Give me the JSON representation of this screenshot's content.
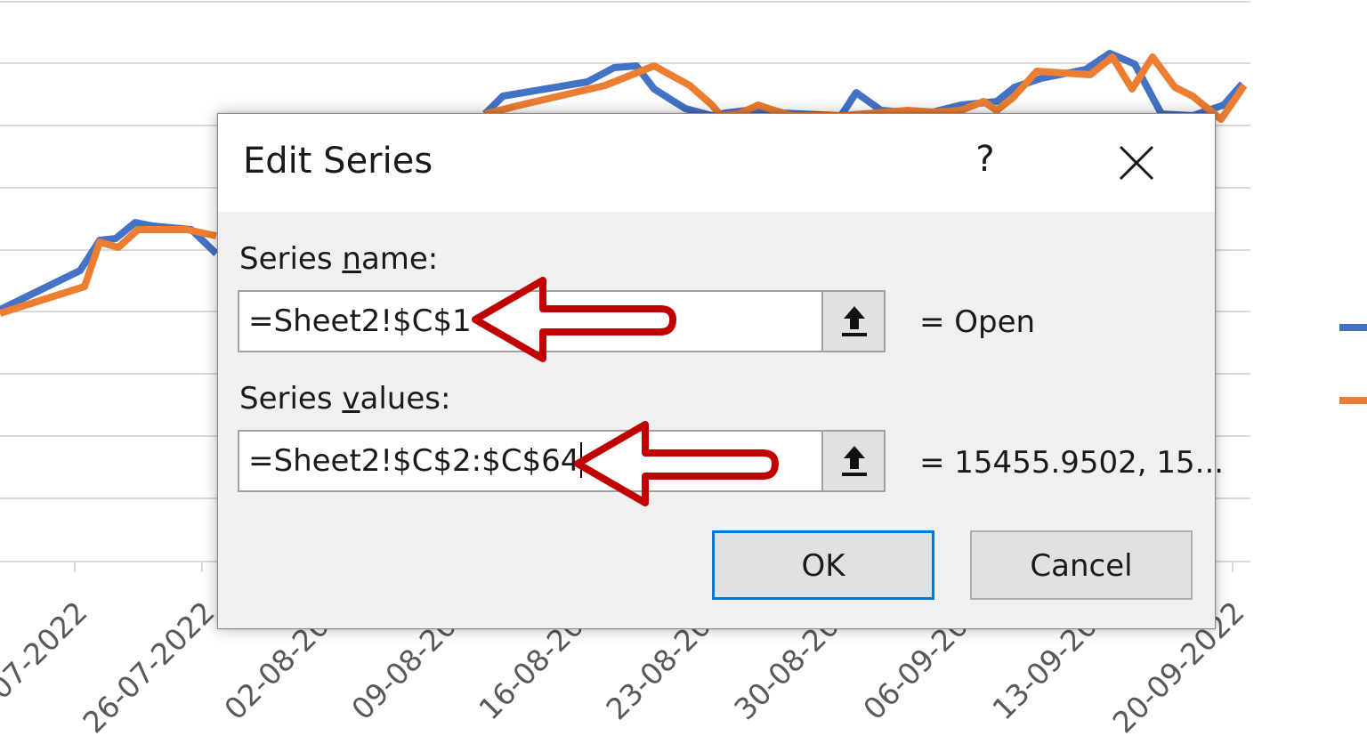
{
  "background_chart": {
    "x_tick_labels": [
      "07-2022",
      "26-07-2022",
      "02-08-202",
      "09-08-202",
      "16-08-202",
      "23-08-202",
      "30-08-202",
      "06-09-202",
      "13-09-202",
      "20-09-2022"
    ],
    "series_colors": [
      "#4472c4",
      "#ed7d31"
    ]
  },
  "dialog": {
    "title": "Edit Series",
    "help_label": "?",
    "close_icon": "close-icon",
    "series_name": {
      "label_pre": "Series ",
      "label_accel": "n",
      "label_post": "ame:",
      "value": "=Sheet2!$C$1",
      "preview": "= Open"
    },
    "series_values": {
      "label_pre": "Series ",
      "label_accel": "v",
      "label_post": "alues:",
      "value": "=Sheet2!$C$2:$C$64",
      "preview": "= 15455.9502, 15..."
    },
    "collapse_icon": "collapse-upload-icon",
    "ok_label": "OK",
    "cancel_label": "Cancel"
  },
  "annotation_color": "#c00000"
}
